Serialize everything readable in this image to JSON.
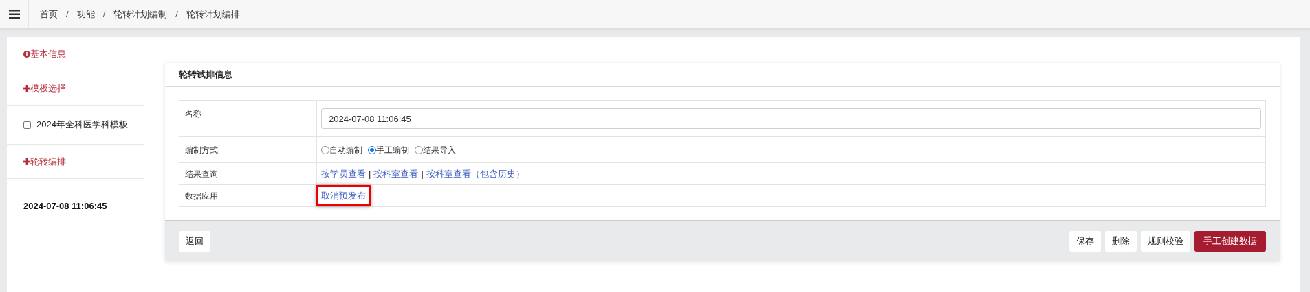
{
  "breadcrumb": [
    {
      "kind": "link",
      "label": "首页"
    },
    {
      "kind": "separator",
      "label": "/"
    },
    {
      "kind": "link",
      "label": "功能"
    },
    {
      "kind": "separator",
      "label": "/"
    },
    {
      "kind": "link",
      "label": "轮转计划编制"
    },
    {
      "kind": "separator",
      "label": "/"
    },
    {
      "kind": "link",
      "label": "轮转计划编排"
    }
  ],
  "sidebar": {
    "items": [
      {
        "kind": "info",
        "label": "基本信息"
      },
      {
        "kind": "plus",
        "label": "模板选择"
      },
      {
        "kind": "checkbox",
        "label": "2024年全科医学科模板",
        "checked": false
      },
      {
        "kind": "plus",
        "label": "轮转编排"
      },
      {
        "kind": "bold",
        "label": "2024-07-08 11:06:45"
      }
    ]
  },
  "card": {
    "title": "轮转试排信息",
    "rows": [
      {
        "kind": "input",
        "label": "名称",
        "value": "2024-07-08 11:06:45"
      },
      {
        "kind": "radios",
        "label": "编制方式",
        "options": [
          {
            "label": "自动编制",
            "selected": false
          },
          {
            "label": "手工编制",
            "selected": true
          },
          {
            "label": "结果导入",
            "selected": false
          }
        ]
      },
      {
        "kind": "links",
        "label": "结果查询",
        "links": [
          {
            "kind": "link",
            "label": "按学员查看",
            "highlighted": false
          },
          {
            "kind": "separator",
            "label": "|",
            "highlighted": false
          },
          {
            "kind": "link",
            "label": "按科室查看",
            "highlighted": false
          },
          {
            "kind": "separator",
            "label": "|",
            "highlighted": false
          },
          {
            "kind": "link",
            "label": "按科室查看（包含历史）",
            "highlighted": false
          }
        ]
      },
      {
        "kind": "links",
        "label": "数据应用",
        "links": [
          {
            "kind": "link",
            "label": "取消预发布",
            "highlighted": true
          }
        ]
      }
    ],
    "footer": {
      "left": [
        {
          "label": "返回",
          "primary": false
        }
      ],
      "right": [
        {
          "label": "保存",
          "primary": false
        },
        {
          "label": "删除",
          "primary": false
        },
        {
          "label": "规则校验",
          "primary": false
        },
        {
          "label": "手工创建数据",
          "primary": true
        }
      ]
    }
  }
}
